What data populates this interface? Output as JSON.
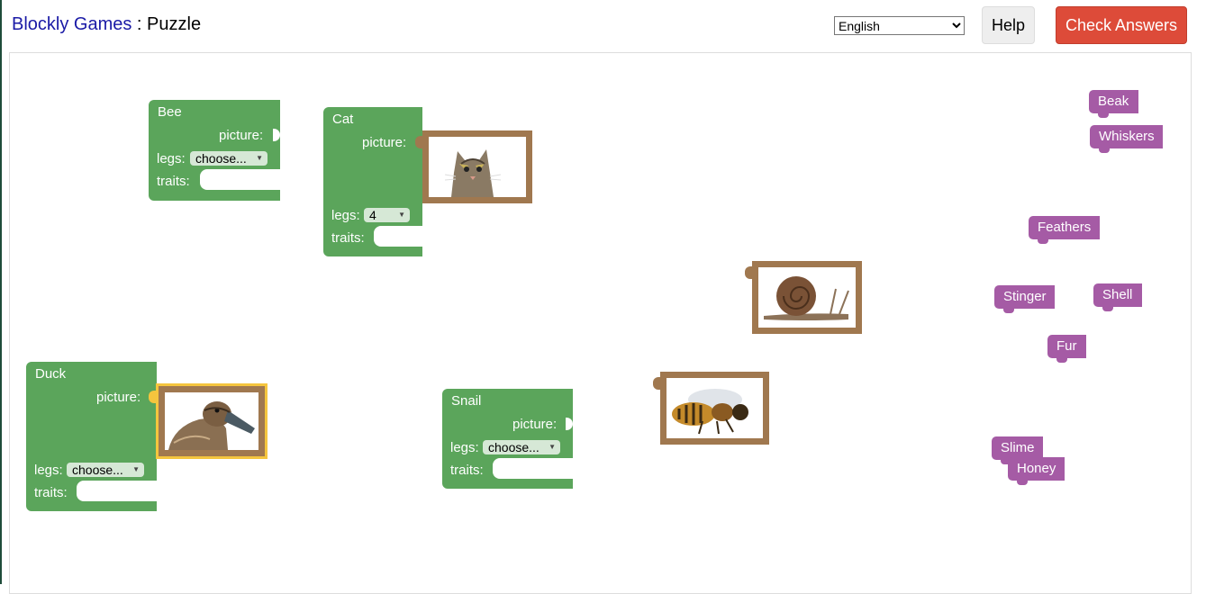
{
  "header": {
    "app_link": "Blockly Games",
    "separator": " : ",
    "page_title": "Puzzle",
    "language": "English",
    "help_label": "Help",
    "check_label": "Check Answers"
  },
  "blocks": {
    "bee": {
      "name": "Bee",
      "picture_label": "picture:",
      "legs_label": "legs:",
      "legs_value": "choose...",
      "traits_label": "traits:"
    },
    "cat": {
      "name": "Cat",
      "picture_label": "picture:",
      "legs_label": "legs:",
      "legs_value": "4",
      "traits_label": "traits:"
    },
    "duck": {
      "name": "Duck",
      "picture_label": "picture:",
      "legs_label": "legs:",
      "legs_value": "choose...",
      "traits_label": "traits:"
    },
    "snail": {
      "name": "Snail",
      "picture_label": "picture:",
      "legs_label": "legs:",
      "legs_value": "choose...",
      "traits_label": "traits:"
    }
  },
  "traits": [
    "Beak",
    "Whiskers",
    "Feathers",
    "Stinger",
    "Shell",
    "Fur",
    "Slime",
    "Honey"
  ],
  "colors": {
    "animal_block": "#5ba55b",
    "trait_block": "#a55ba5",
    "picture_block": "#a0784f",
    "check_button": "#dd4b39",
    "link": "#1a1aa6"
  }
}
